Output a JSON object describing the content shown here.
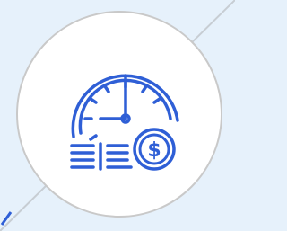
{
  "icon": {
    "name": "time-is-money-icon",
    "parts": [
      "clock-icon",
      "coin-stack-icon",
      "dollar-coin-icon"
    ],
    "symbol": "$"
  },
  "colors": {
    "background": "#e6f1fb",
    "circle_fill": "#ffffff",
    "circle_border": "#c9c9c9",
    "icon_stroke": "#2f5fd6",
    "diagonal_line": "#c7cdd3"
  }
}
